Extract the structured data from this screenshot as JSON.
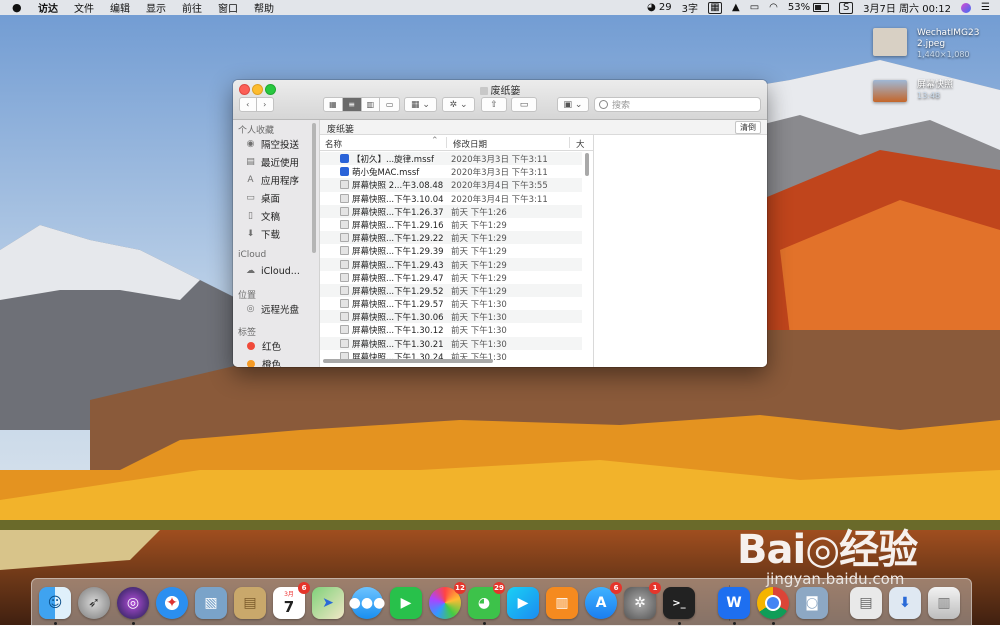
{
  "menubar": {
    "app_name": "访达",
    "items": [
      "文件",
      "编辑",
      "显示",
      "前往",
      "窗口",
      "帮助"
    ],
    "wechat_count": "29",
    "input_method": "3字",
    "battery": "53%",
    "clock": "3月7日 周六  00:12"
  },
  "desktop": {
    "files": [
      {
        "name": "WechatIMG232.jpeg",
        "meta": "1,440×1,080"
      },
      {
        "name": "屏幕快照",
        "meta": "13:48"
      }
    ]
  },
  "window": {
    "title": "废纸篓",
    "search_placeholder": "搜索",
    "path_title": "废纸篓",
    "empty_button": "清倒",
    "columns": {
      "name": "名称",
      "date": "修改日期",
      "size": "大"
    },
    "files": [
      {
        "name": "【初久】...旋律.mssf",
        "date": "2020年3月3日 下午3:11",
        "icon": "app-file"
      },
      {
        "name": "萌小兔MAC.mssf",
        "date": "2020年3月3日 下午3:11",
        "icon": "app-file"
      },
      {
        "name": "屏幕快照 2...午3.08.48",
        "date": "2020年3月4日 下午3:55",
        "icon": "image-file"
      },
      {
        "name": "屏幕快照...下午3.10.04",
        "date": "2020年3月4日 下午3:11",
        "icon": "image-file"
      },
      {
        "name": "屏幕快照...下午1.26.37",
        "date": "前天 下午1:26",
        "icon": "image-file"
      },
      {
        "name": "屏幕快照...下午1.29.16",
        "date": "前天 下午1:29",
        "icon": "image-file"
      },
      {
        "name": "屏幕快照...下午1.29.22",
        "date": "前天 下午1:29",
        "icon": "image-file"
      },
      {
        "name": "屏幕快照...下午1.29.39",
        "date": "前天 下午1:29",
        "icon": "image-file"
      },
      {
        "name": "屏幕快照...下午1.29.43",
        "date": "前天 下午1:29",
        "icon": "image-file"
      },
      {
        "name": "屏幕快照...下午1.29.47",
        "date": "前天 下午1:29",
        "icon": "image-file"
      },
      {
        "name": "屏幕快照...下午1.29.52",
        "date": "前天 下午1:29",
        "icon": "image-file"
      },
      {
        "name": "屏幕快照...下午1.29.57",
        "date": "前天 下午1:30",
        "icon": "image-file"
      },
      {
        "name": "屏幕快照...下午1.30.06",
        "date": "前天 下午1:30",
        "icon": "image-file"
      },
      {
        "name": "屏幕快照...下午1.30.12",
        "date": "前天 下午1:30",
        "icon": "image-file"
      },
      {
        "name": "屏幕快照...下午1.30.21",
        "date": "前天 下午1:30",
        "icon": "image-file"
      },
      {
        "name": "屏幕快照...下午1.30.24",
        "date": "前天 下午1:30",
        "icon": "image-file"
      }
    ]
  },
  "sidebar": {
    "favorites_header": "个人收藏",
    "favorites": [
      {
        "label": "隔空投送",
        "icon": "airdrop-icon",
        "glyph": "◉"
      },
      {
        "label": "最近使用",
        "icon": "recents-icon",
        "glyph": "▤"
      },
      {
        "label": "应用程序",
        "icon": "applications-icon",
        "glyph": "A"
      },
      {
        "label": "桌面",
        "icon": "desktop-icon",
        "glyph": "▭"
      },
      {
        "label": "文稿",
        "icon": "documents-icon",
        "glyph": "▯"
      },
      {
        "label": "下载",
        "icon": "downloads-icon",
        "glyph": "⬇"
      }
    ],
    "icloud_header": "iCloud",
    "icloud_item": "iCloud...",
    "locations_header": "位置",
    "locations_item": "远程光盘",
    "tags_header": "标签",
    "tags": [
      {
        "label": "红色",
        "color": "#f04a3a"
      },
      {
        "label": "橙色",
        "color": "#f59a25"
      }
    ]
  },
  "dock": {
    "badges": {
      "calendar": "6",
      "photos": "12",
      "wechat": "29",
      "appstore": "6",
      "prefs": "1"
    },
    "calendar_day": "7",
    "calendar_month": "3月"
  },
  "watermark": {
    "logo": "Bai◎经验",
    "url": "jingyan.baidu.com"
  }
}
